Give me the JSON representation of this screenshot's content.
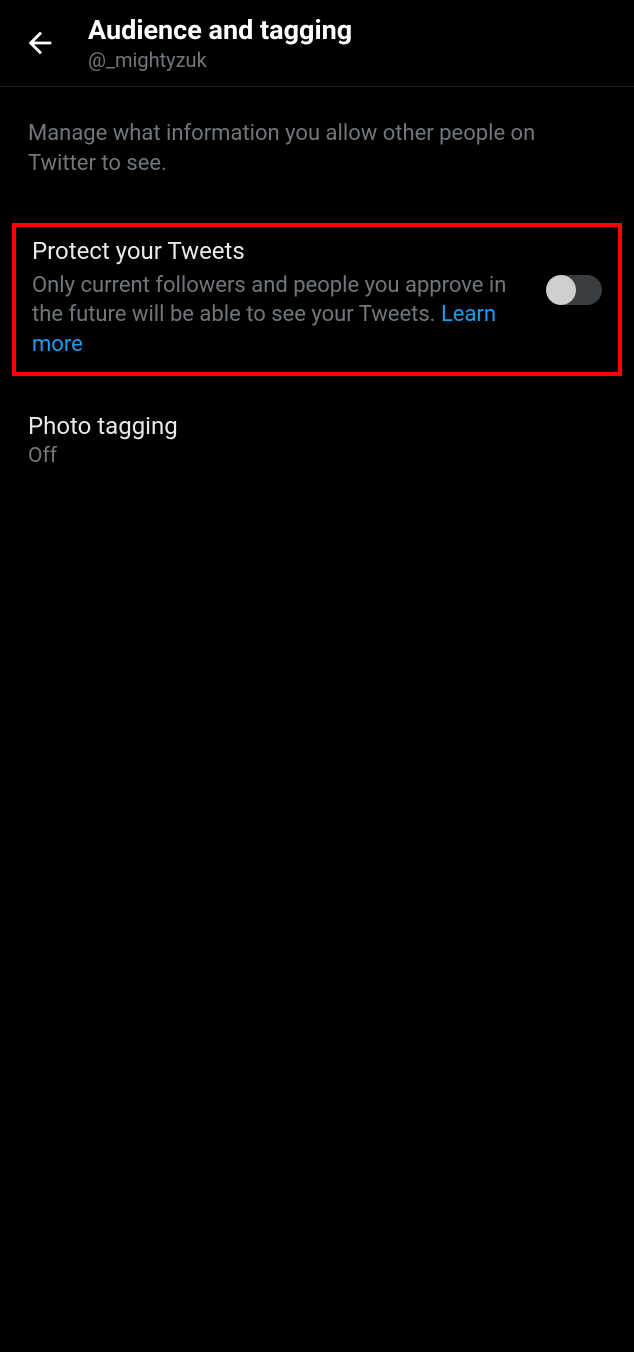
{
  "header": {
    "title": "Audience and tagging",
    "subtitle": "@_mightyzuk"
  },
  "description": "Manage what information you allow other people on Twitter to see.",
  "settings": {
    "protect_tweets": {
      "title": "Protect your Tweets",
      "description": "Only current followers and people you approve in the future will be able to see your Tweets. ",
      "learn_more": "Learn more",
      "toggle_on": false,
      "highlighted": true
    },
    "photo_tagging": {
      "title": "Photo tagging",
      "status": "Off"
    }
  }
}
